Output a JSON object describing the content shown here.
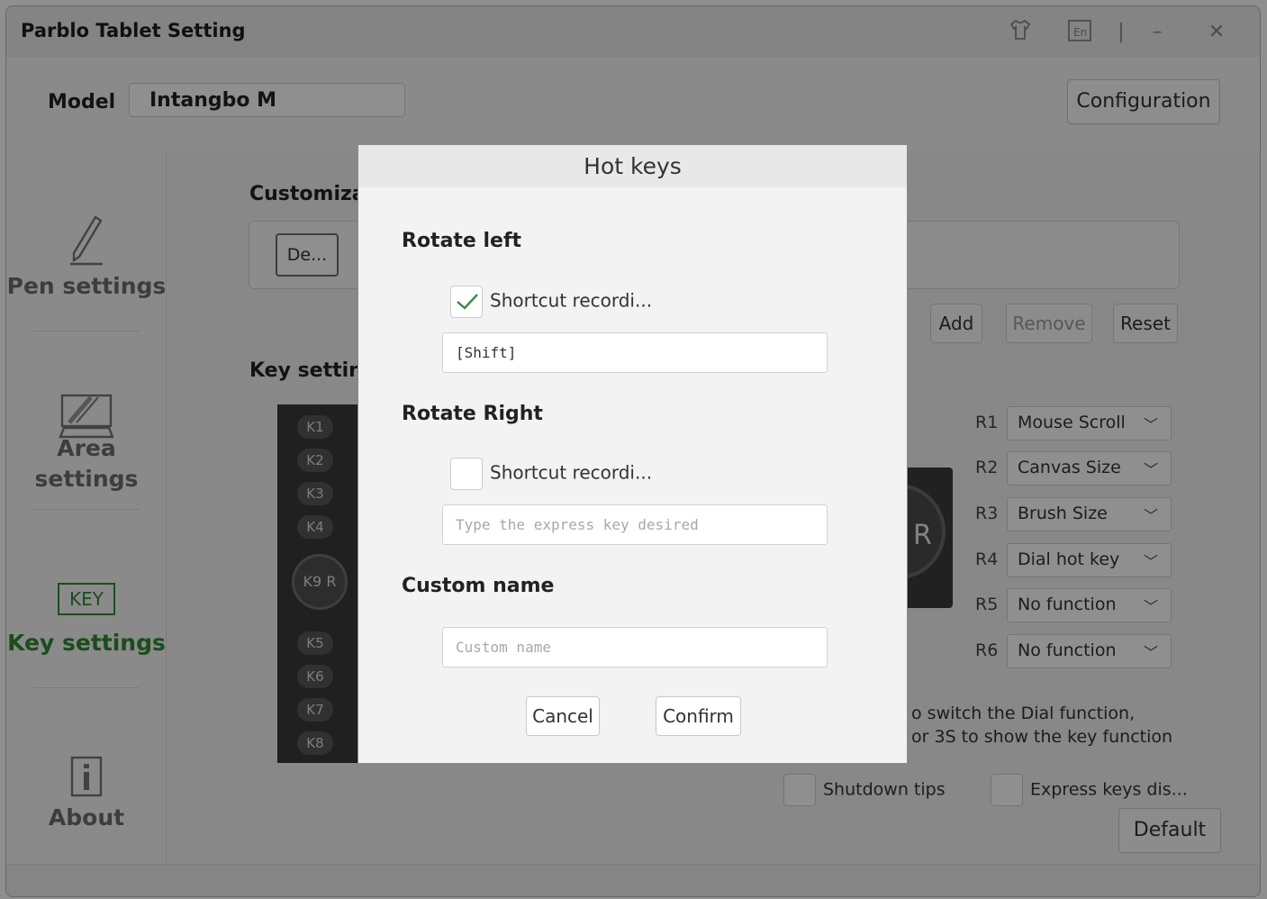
{
  "app": {
    "title": "Parblo Tablet Setting",
    "model_label": "Model",
    "model_value": "Intangbo M",
    "configuration_label": "Configuration"
  },
  "sidebar": {
    "items": [
      {
        "label": "Pen settings",
        "icon": "pen-icon"
      },
      {
        "label": "Area settings",
        "icon": "tablet-area-icon"
      },
      {
        "label": "Key settings",
        "icon": "key-icon",
        "badge": "KEY"
      },
      {
        "label": "About",
        "icon": "info-icon"
      }
    ]
  },
  "main": {
    "customization_title": "Customizat",
    "de_button": "De...",
    "add_label": "Add",
    "remove_label": "Remove",
    "reset_label": "Reset",
    "key_setting_title": "Key setting",
    "keys": [
      "K1",
      "K2",
      "K3",
      "K4",
      "K5",
      "K6",
      "K7",
      "K8"
    ],
    "dial_label": "K9 R",
    "dial_ring_label": "R",
    "dial_rows": [
      {
        "label": "R1",
        "value": "Mouse Scroll"
      },
      {
        "label": "R2",
        "value": "Canvas Size"
      },
      {
        "label": "R3",
        "value": "Brush Size"
      },
      {
        "label": "R4",
        "value": "Dial hot key"
      },
      {
        "label": "R5",
        "value": "No function"
      },
      {
        "label": "R6",
        "value": "No function"
      }
    ],
    "info_line1": "o switch the Dial function,",
    "info_line2": "or 3S to show the key function",
    "shutdown_tips": "Shutdown tips",
    "express_keys": "Express keys dis...",
    "default_label": "Default"
  },
  "dialog": {
    "title": "Hot keys",
    "rotate_left_title": "Rotate left",
    "rotate_left_check_label": "Shortcut recordi...",
    "rotate_left_checked": true,
    "rotate_left_value": "[Shift]",
    "rotate_right_title": "Rotate Right",
    "rotate_right_check_label": "Shortcut recordi...",
    "rotate_right_checked": false,
    "rotate_right_placeholder": "Type the express key desired",
    "custom_name_title": "Custom name",
    "custom_name_placeholder": "Custom name",
    "cancel_label": "Cancel",
    "confirm_label": "Confirm"
  },
  "colors": {
    "accent_green": "#2f8a32",
    "overlay": "rgba(0,0,0,0.44)"
  }
}
